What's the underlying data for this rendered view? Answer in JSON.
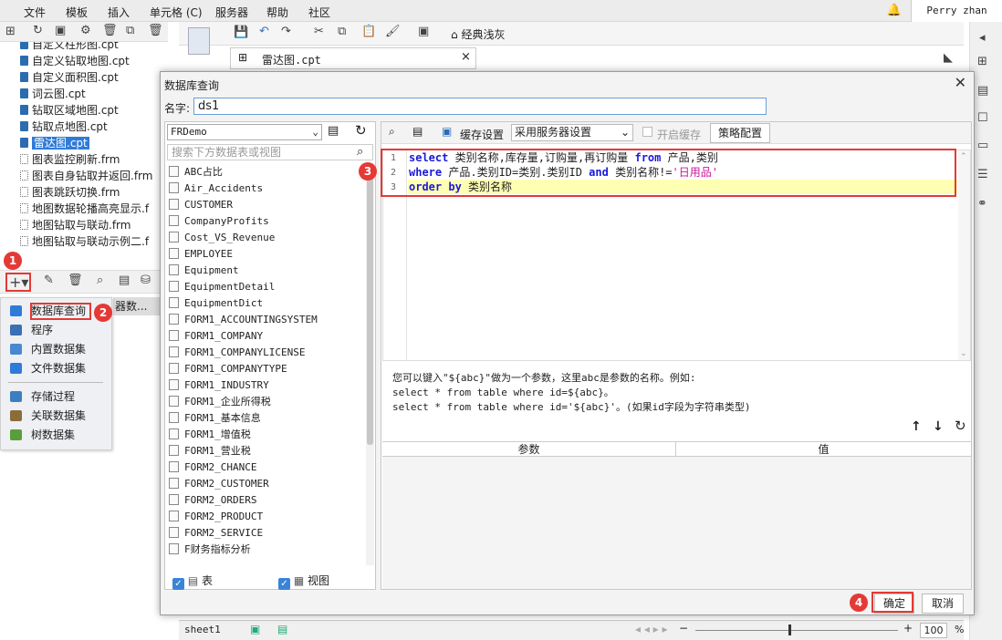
{
  "menu": [
    "文件",
    "模板",
    "插入",
    "单元格 (C)",
    "服务器",
    "帮助",
    "社区"
  ],
  "user": "Perry zhan",
  "files": [
    {
      "name": "自定义柱形图.cpt",
      "type": "cpt"
    },
    {
      "name": "自定义钻取地图.cpt",
      "type": "cpt"
    },
    {
      "name": "自定义面积图.cpt",
      "type": "cpt"
    },
    {
      "name": "词云图.cpt",
      "type": "cpt"
    },
    {
      "name": "钻取区域地图.cpt",
      "type": "cpt"
    },
    {
      "name": "钻取点地图.cpt",
      "type": "cpt"
    },
    {
      "name": "雷达图.cpt",
      "type": "cpt",
      "selected": true
    },
    {
      "name": "图表监控刷新.frm",
      "type": "frm"
    },
    {
      "name": "图表自身钻取并返回.frm",
      "type": "frm"
    },
    {
      "name": "图表跳跃切换.frm",
      "type": "frm"
    },
    {
      "name": "地图数据轮播高亮显示.f",
      "type": "frm"
    },
    {
      "name": "地图钻取与联动.frm",
      "type": "frm"
    },
    {
      "name": "地图钻取与联动示例二.f",
      "type": "frm"
    }
  ],
  "popmenu": [
    {
      "label": "数据库查询",
      "color": "#2f7bd8"
    },
    {
      "label": "程序",
      "color": "#3c6fb3"
    },
    {
      "label": "内置数据集",
      "color": "#4a88d0"
    },
    {
      "label": "文件数据集",
      "color": "#2f7bd8"
    },
    {
      "label": "存储过程",
      "color": "#3a7fc0"
    },
    {
      "label": "关联数据集",
      "color": "#8a6d3b"
    },
    {
      "label": "树数据集",
      "color": "#5a9e3b"
    }
  ],
  "server_ds_partial": "器数...",
  "toolbar": {
    "style_label": "经典浅灰"
  },
  "tab": {
    "label": "雷达图.cpt"
  },
  "dialog": {
    "title": "数据库查询",
    "name_label": "名字:",
    "name_value": "ds1",
    "connection": "FRDemo",
    "search_placeholder": "搜索下方数据表或视图",
    "tables": [
      "ABC占比",
      "Air_Accidents",
      "CUSTOMER",
      "CompanyProfits",
      "Cost_VS_Revenue",
      "EMPLOYEE",
      "Equipment",
      "EquipmentDetail",
      "EquipmentDict",
      "FORM1_ACCOUNTINGSYSTEM",
      "FORM1_COMPANY",
      "FORM1_COMPANYLICENSE",
      "FORM1_COMPANYTYPE",
      "FORM1_INDUSTRY",
      "FORM1_企业所得税",
      "FORM1_基本信息",
      "FORM1_增值税",
      "FORM1_营业税",
      "FORM2_CHANCE",
      "FORM2_CUSTOMER",
      "FORM2_ORDERS",
      "FORM2_PRODUCT",
      "FORM2_SERVICE",
      "F财务指标分析"
    ],
    "chk_table": "表",
    "chk_view": "视图",
    "cache_label": "缓存设置",
    "cache_value": "采用服务器设置",
    "enable_cache": "开启缓存",
    "strategy": "策略配置",
    "sql_line_numbers": [
      "1",
      "2",
      "3"
    ],
    "hint_line1": "您可以键入\"${abc}\"做为一个参数，这里abc是参数的名称。例如:",
    "hint_line2": "select * from table where id=${abc}。",
    "hint_line3": "select * from table where id='${abc}'。(如果id字段为字符串类型)",
    "col_param": "参数",
    "col_value": "值",
    "ok": "确定",
    "cancel": "取消"
  },
  "sql": {
    "l1_kw1": "select",
    "l1_t1": " 类别名称,库存量,订购量,再订购量 ",
    "l1_kw2": "from",
    "l1_t2": " 产品,类别",
    "l2_kw1": "where",
    "l2_t1": " 产品.类别ID=类别.类别ID ",
    "l2_kw2": "and",
    "l2_t2": " 类别名称!=",
    "l2_str": "'日用品'",
    "l3_kw1": "order by",
    "l3_t1": " 类别名称"
  },
  "badges": [
    "1",
    "2",
    "3",
    "4"
  ],
  "bottom": {
    "sheet": "sheet1",
    "zoom": "100",
    "pct": "%"
  }
}
